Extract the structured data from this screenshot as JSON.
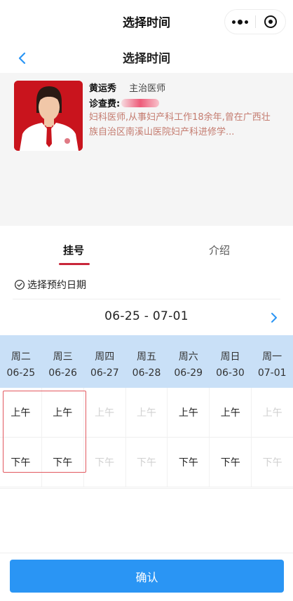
{
  "titlebar": {
    "title": "选择时间"
  },
  "header": {
    "title": "选择时间"
  },
  "doctor": {
    "name": "黄运秀",
    "title": "主治医师",
    "fee_label": "诊查费:",
    "bio": "妇科医师,从事妇产科工作18余年,曾在广西壮族自治区南溪山医院妇产科进修学..."
  },
  "tabs": [
    {
      "label": "挂号",
      "active": true
    },
    {
      "label": "介绍",
      "active": false
    }
  ],
  "select_date_label": "选择预约日期",
  "date_range": "06-25 - 07-01",
  "week": [
    {
      "day": "周二",
      "date": "06-25"
    },
    {
      "day": "周三",
      "date": "06-26"
    },
    {
      "day": "周四",
      "date": "06-27"
    },
    {
      "day": "周五",
      "date": "06-28"
    },
    {
      "day": "周六",
      "date": "06-29"
    },
    {
      "day": "周日",
      "date": "06-30"
    },
    {
      "day": "周一",
      "date": "07-01"
    }
  ],
  "slots": {
    "morning": [
      {
        "label": "上午",
        "available": true
      },
      {
        "label": "上午",
        "available": true
      },
      {
        "label": "上午",
        "available": false
      },
      {
        "label": "上午",
        "available": false
      },
      {
        "label": "上午",
        "available": true
      },
      {
        "label": "上午",
        "available": true
      },
      {
        "label": "上午",
        "available": false
      }
    ],
    "afternoon": [
      {
        "label": "下午",
        "available": true
      },
      {
        "label": "下午",
        "available": true
      },
      {
        "label": "下午",
        "available": false
      },
      {
        "label": "下午",
        "available": false
      },
      {
        "label": "下午",
        "available": true
      },
      {
        "label": "下午",
        "available": true
      },
      {
        "label": "下午",
        "available": false
      }
    ]
  },
  "confirm_label": "确认",
  "colors": {
    "accent": "#2a95f4",
    "tab_underline": "#c8273a",
    "week_header_bg": "#c9e0f7",
    "highlight": "#e2585f",
    "bio_text": "#c47b6f"
  }
}
